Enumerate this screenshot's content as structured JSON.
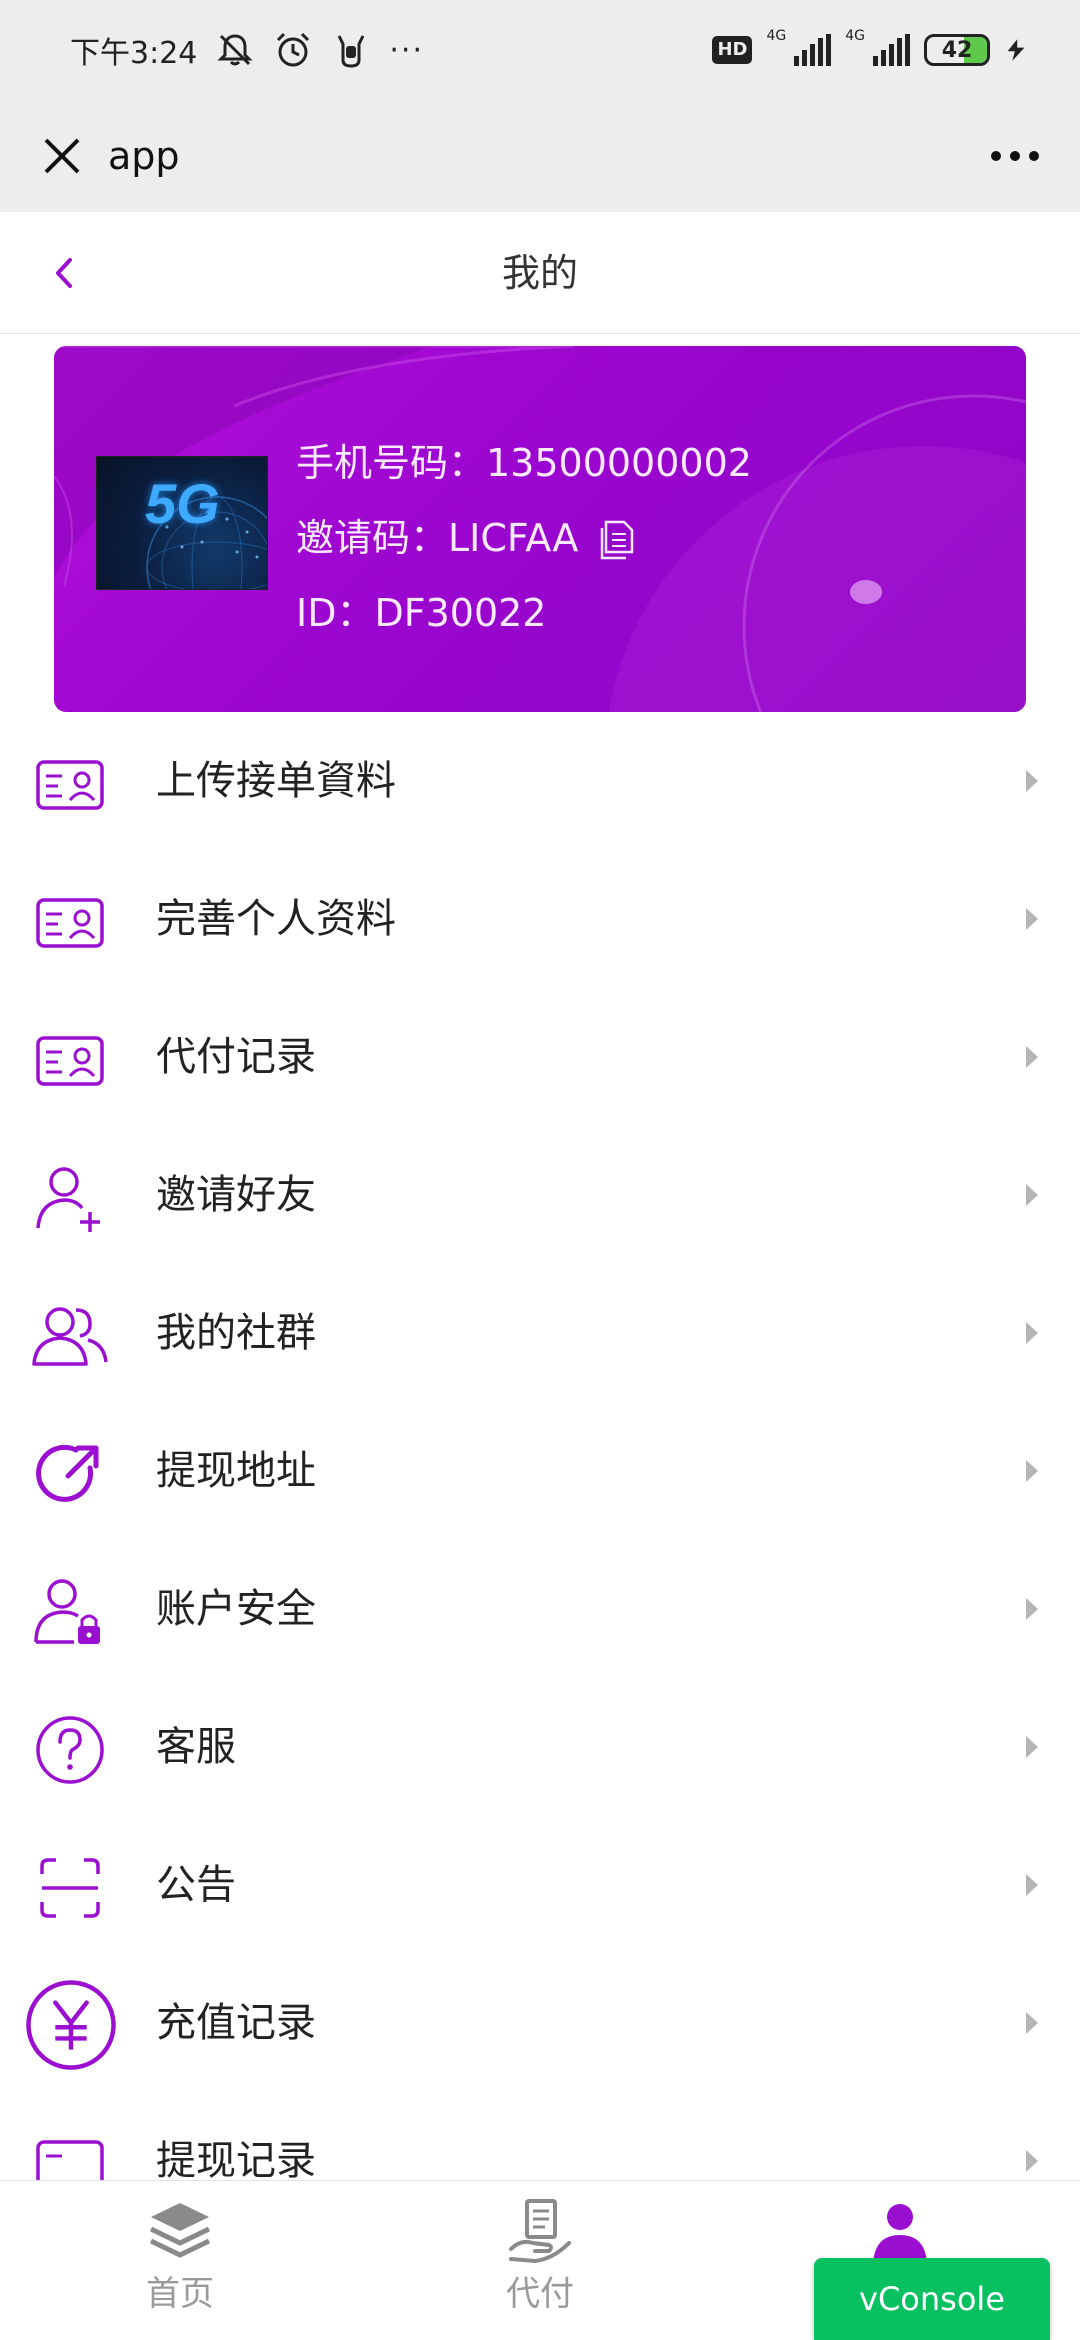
{
  "status_bar": {
    "time": "下午3:24",
    "hd_label": "HD",
    "net1": "4G",
    "net2": "4G",
    "battery": "42"
  },
  "app_bar": {
    "title": "app",
    "close_icon": "close-icon",
    "more_icon": "more-dots-icon"
  },
  "header": {
    "title": "我的",
    "back_icon": "chevron-left-icon"
  },
  "profile": {
    "avatar_text": "5G",
    "phone": "手机号码：13500000002",
    "invite_code": "邀请码：LICFAA",
    "id": "ID：DF30022",
    "copy_icon": "copy-icon"
  },
  "menu": {
    "items": [
      {
        "label": "上传接单資料",
        "icon": "id-card-icon"
      },
      {
        "label": "完善个人资料",
        "icon": "id-card-icon"
      },
      {
        "label": "代付记录",
        "icon": "id-card-icon"
      },
      {
        "label": "邀请好友",
        "icon": "user-plus-icon"
      },
      {
        "label": "我的社群",
        "icon": "users-icon"
      },
      {
        "label": "提现地址",
        "icon": "arrow-out-circle-icon"
      },
      {
        "label": "账户安全",
        "icon": "user-lock-icon"
      },
      {
        "label": "客服",
        "icon": "question-circle-icon"
      },
      {
        "label": "公告",
        "icon": "scan-frame-icon"
      },
      {
        "label": "充值记录",
        "icon": "yuan-circle-icon"
      },
      {
        "label": "提现记录",
        "icon": "id-card-icon"
      }
    ]
  },
  "tabs": [
    {
      "label": "首页",
      "icon": "layers-icon"
    },
    {
      "label": "代付",
      "icon": "hand-receipt-icon"
    },
    {
      "label": "",
      "icon": "user-icon"
    }
  ],
  "vconsole": {
    "label": "vConsole"
  },
  "colors": {
    "accent": "#9b0fd1",
    "card_start": "#b10fd9",
    "card_end": "#8e04c4",
    "vconsole": "#07c05f"
  }
}
